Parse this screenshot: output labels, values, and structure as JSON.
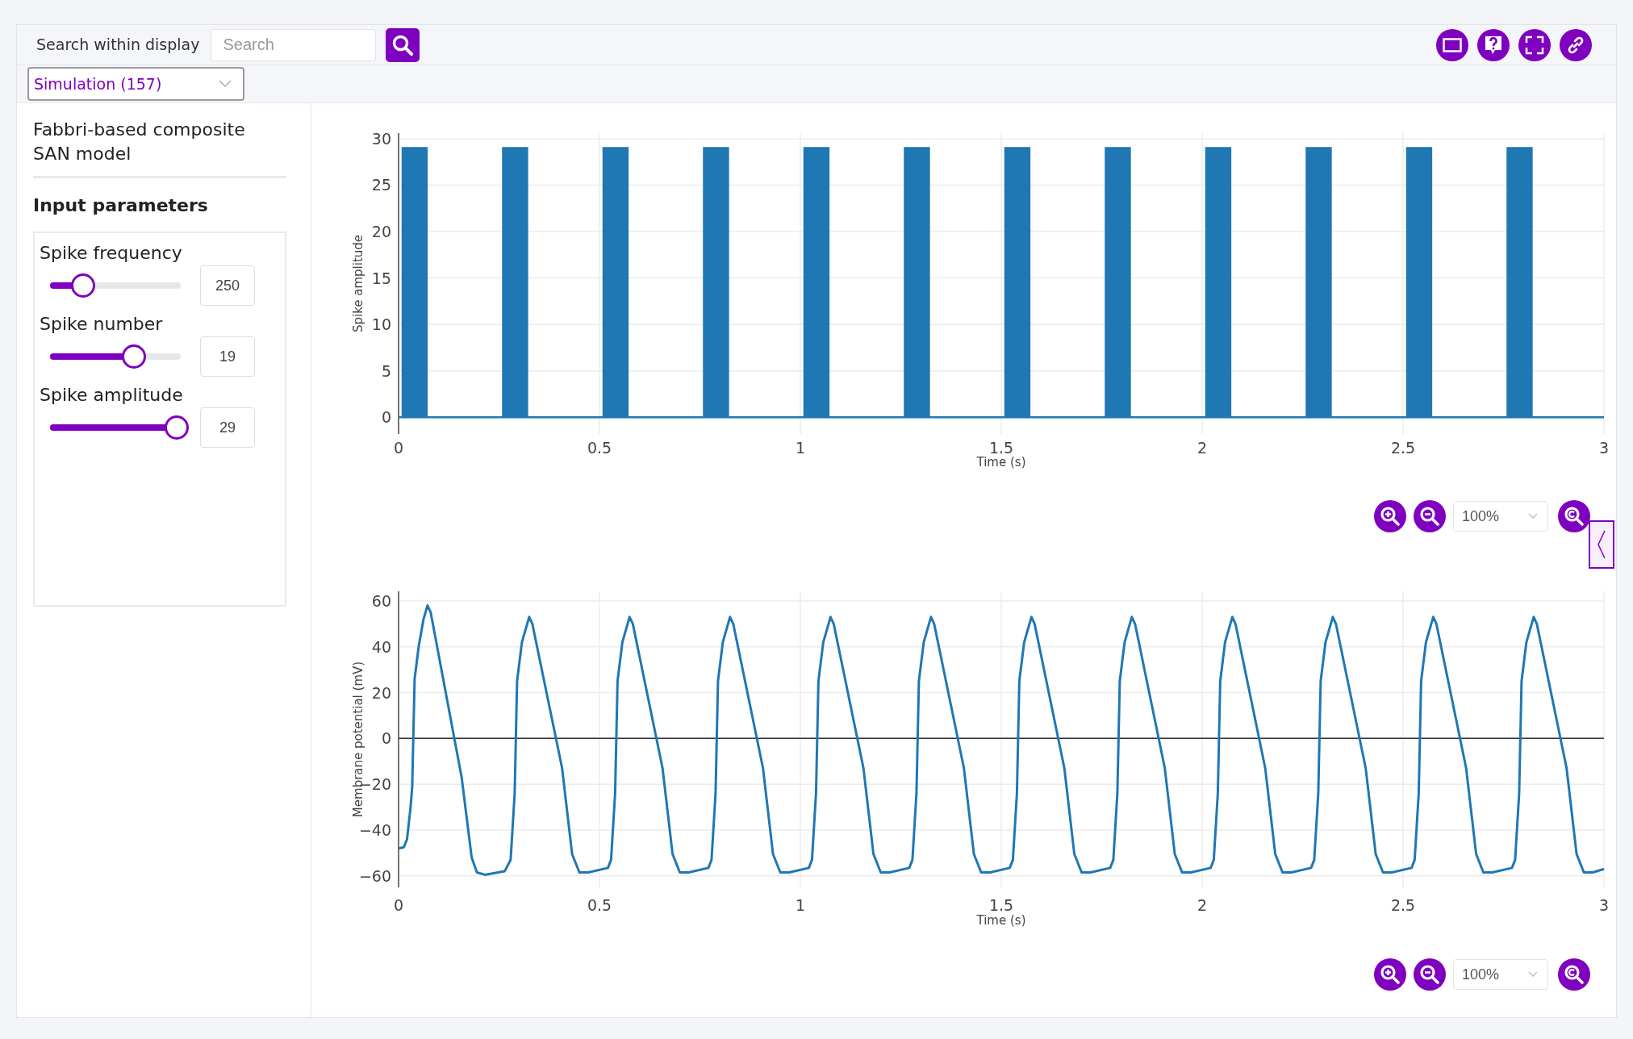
{
  "toolbar": {
    "search_label": "Search within display",
    "search": {
      "placeholder": "Search"
    }
  },
  "simulation_select": {
    "value": "Simulation (157)"
  },
  "sidebar": {
    "title": "Fabbri-based composite SAN model",
    "section_title": "Input parameters",
    "parameters": [
      {
        "label": "Spike frequency",
        "level": 0.25,
        "value": "250"
      },
      {
        "label": "Spike number",
        "level": 0.64,
        "value": "19"
      },
      {
        "label": "Spike amplitude",
        "level": 0.97,
        "value": "29"
      }
    ]
  },
  "plots": [
    {
      "zoom": {
        "value": "100%"
      },
      "chart_data": {
        "type": "area",
        "xlabel": "Time (s)",
        "ylabel": "Spike amplitude",
        "x": [
          0,
          0.01,
          0.01,
          0.07,
          0.07,
          0.26,
          0.26,
          0.32,
          0.32,
          0.51,
          0.51,
          0.57,
          0.57,
          0.76,
          0.76,
          0.82,
          0.82,
          1.01,
          1.01,
          1.07,
          1.07,
          1.26,
          1.26,
          1.32,
          1.32,
          1.51,
          1.51,
          1.57,
          1.57,
          1.76,
          1.76,
          1.82,
          1.82,
          2.01,
          2.01,
          2.07,
          2.07,
          2.26,
          2.26,
          2.32,
          2.32,
          2.51,
          2.51,
          2.57,
          2.57,
          2.76,
          2.76,
          2.82,
          2.82,
          3
        ],
        "series": [
          {
            "color": "#1f77b4",
            "values": [
              0,
              0,
              29,
              29,
              0,
              0,
              29,
              29,
              0,
              0,
              29,
              29,
              0,
              0,
              29,
              29,
              0,
              0,
              29,
              29,
              0,
              0,
              29,
              29,
              0,
              0,
              29,
              29,
              0,
              0,
              29,
              29,
              0,
              0,
              29,
              29,
              0,
              0,
              29,
              29,
              0,
              0,
              29,
              29,
              0,
              0,
              29,
              29,
              0,
              0
            ]
          }
        ],
        "grid": true,
        "xlim": [
          0,
          3
        ],
        "ylim": [
          -1.8,
          30.6
        ],
        "xticks": [
          0,
          0.5,
          1,
          1.5,
          2,
          2.5,
          3
        ],
        "yticks": [
          0,
          5,
          10,
          15,
          20,
          25,
          30
        ]
      }
    },
    {
      "zoom": {
        "value": "100%"
      },
      "chart_data": {
        "type": "line",
        "xlabel": "Time (s)",
        "ylabel": "Membrane potential (mV)",
        "x": [
          0,
          0.013,
          0.021,
          0.03,
          0.034,
          0.04,
          0.05,
          0.062,
          0.072,
          0.08,
          0.157,
          0.182,
          0.195,
          0.215,
          0.264,
          0.279,
          0.289,
          0.295,
          0.307,
          0.325,
          0.333,
          0.407,
          0.432,
          0.45,
          0.472,
          0.521,
          0.529,
          0.539,
          0.545,
          0.557,
          0.575,
          0.583,
          0.657,
          0.682,
          0.7,
          0.722,
          0.771,
          0.779,
          0.789,
          0.795,
          0.807,
          0.825,
          0.833,
          0.907,
          0.932,
          0.95,
          0.972,
          1.021,
          1.029,
          1.039,
          1.045,
          1.057,
          1.075,
          1.083,
          1.157,
          1.182,
          1.2,
          1.222,
          1.271,
          1.279,
          1.289,
          1.295,
          1.307,
          1.325,
          1.333,
          1.407,
          1.432,
          1.45,
          1.472,
          1.521,
          1.529,
          1.539,
          1.545,
          1.557,
          1.575,
          1.583,
          1.657,
          1.682,
          1.7,
          1.722,
          1.771,
          1.779,
          1.789,
          1.795,
          1.807,
          1.825,
          1.833,
          1.907,
          1.932,
          1.95,
          1.972,
          2.021,
          2.029,
          2.039,
          2.045,
          2.057,
          2.075,
          2.083,
          2.157,
          2.182,
          2.2,
          2.222,
          2.271,
          2.279,
          2.289,
          2.295,
          2.307,
          2.325,
          2.333,
          2.407,
          2.432,
          2.45,
          2.472,
          2.521,
          2.529,
          2.539,
          2.545,
          2.557,
          2.575,
          2.583,
          2.657,
          2.682,
          2.7,
          2.722,
          2.771,
          2.779,
          2.789,
          2.795,
          2.807,
          2.825,
          2.833,
          2.907,
          2.932,
          2.95,
          2.972,
          3
        ],
        "series": [
          {
            "color": "#1f77b4",
            "values": [
              -48,
              -47.5,
              -44,
              -30,
              -21,
              26,
              40,
              52,
              58,
              55,
              -17,
              -52,
              -58.5,
              -59.5,
              -58,
              -53,
              -24,
              25,
              42,
              53,
              50,
              -13,
              -50.5,
              -58.5,
              -58.5,
              -56.5,
              -53,
              -24,
              25,
              42,
              53,
              50,
              -13,
              -50.5,
              -58.5,
              -58.5,
              -56.5,
              -53,
              -24,
              25,
              42,
              53,
              50,
              -13,
              -50.5,
              -58.5,
              -58.5,
              -56.5,
              -53,
              -24,
              25,
              42,
              53,
              50,
              -13,
              -50.5,
              -58.5,
              -58.5,
              -56.5,
              -53,
              -24,
              25,
              42,
              53,
              50,
              -13,
              -50.5,
              -58.5,
              -58.5,
              -56.5,
              -53,
              -24,
              25,
              42,
              53,
              50,
              -13,
              -50.5,
              -58.5,
              -58.5,
              -56.5,
              -53,
              -24,
              25,
              42,
              53,
              50,
              -13,
              -50.5,
              -58.5,
              -58.5,
              -56.5,
              -53,
              -24,
              25,
              42,
              53,
              50,
              -13,
              -50.5,
              -58.5,
              -58.5,
              -56.5,
              -53,
              -24,
              25,
              42,
              53,
              50,
              -13,
              -50.5,
              -58.5,
              -58.5,
              -56.5,
              -53,
              -24,
              25,
              42,
              53,
              50,
              -13,
              -50.5,
              -58.5,
              -58.5,
              -56.5,
              -53,
              -24,
              25,
              42,
              53,
              50,
              -13,
              -50.5,
              -58.5,
              -58.5,
              -57
            ]
          }
        ],
        "grid": true,
        "xlim": [
          0,
          3
        ],
        "ylim": [
          -65,
          64.2
        ],
        "xticks": [
          0,
          0.5,
          1,
          1.5,
          2,
          2.5,
          3
        ],
        "yticks": [
          {
            "value": -60,
            "label": "−60"
          },
          {
            "value": -40,
            "label": "−40"
          },
          {
            "value": -20,
            "label": "−20"
          },
          0,
          20,
          40,
          60
        ]
      }
    }
  ]
}
